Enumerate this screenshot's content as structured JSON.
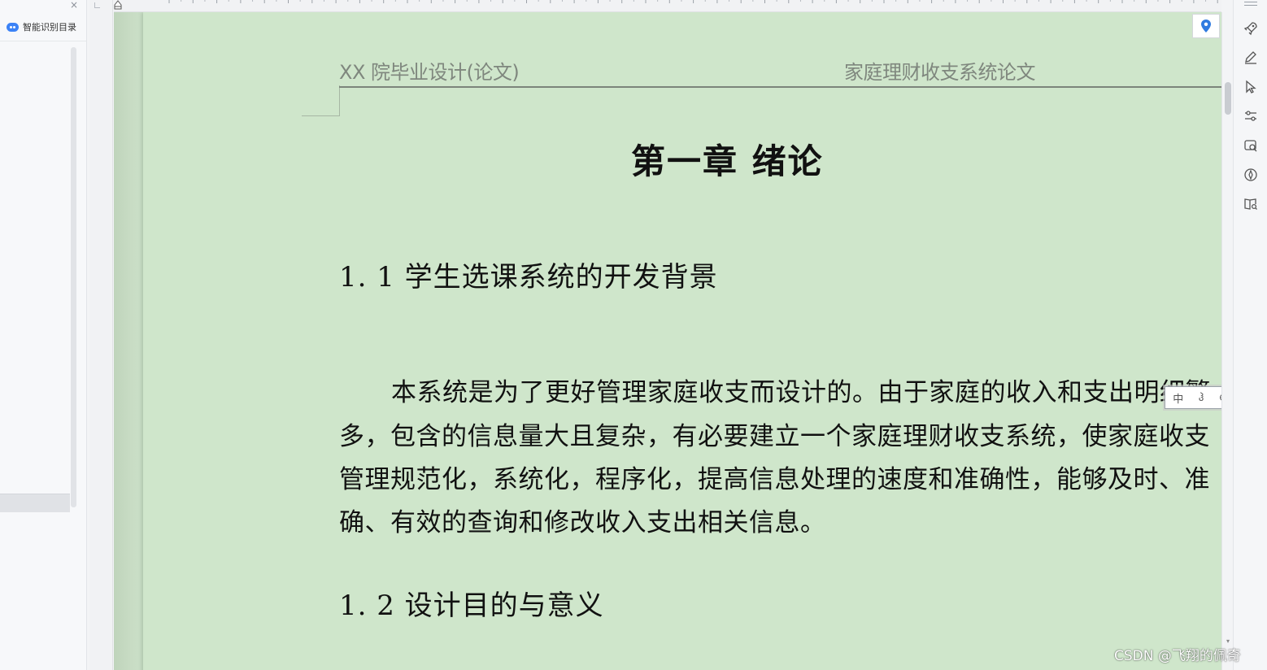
{
  "nav_pane": {
    "title": "智能识别目录",
    "close_glyph": "×"
  },
  "document": {
    "header_left": "XX 院毕业设计(论文)",
    "header_right": "家庭理财收支系统论文",
    "chapter_title": "第一章  绪论",
    "section_1_title": "1. 1  学生选课系统的开发背景",
    "paragraph_lines": [
      "本系统是为了更好管理家庭收支而设计的。由于家庭的收入和支出明细繁",
      "多，包含的信息量大且复杂，有必要建立一个家庭理财收支系统，使家庭收支",
      "管理规范化，系统化，程序化，提高信息处理的速度和准确性，能够及时、准",
      "确、有效的查询和修改收入支出相关信息。"
    ],
    "section_2_title": "1. 2 设计目的与意义"
  },
  "ime_toolbar": {
    "items": [
      "中",
      "ჰ",
      "⊕"
    ]
  },
  "icons": {
    "location": "location-pin-icon",
    "rail": [
      "rocket-icon",
      "pen-icon",
      "cursor-icon",
      "sliders-icon",
      "image-search-icon",
      "compass-icon",
      "book-search-icon"
    ]
  },
  "colors": {
    "canvas_bg": "#cfe4cc",
    "accent_blue": "#2f7be0"
  },
  "watermark": "CSDN @飞翔的佩奇"
}
